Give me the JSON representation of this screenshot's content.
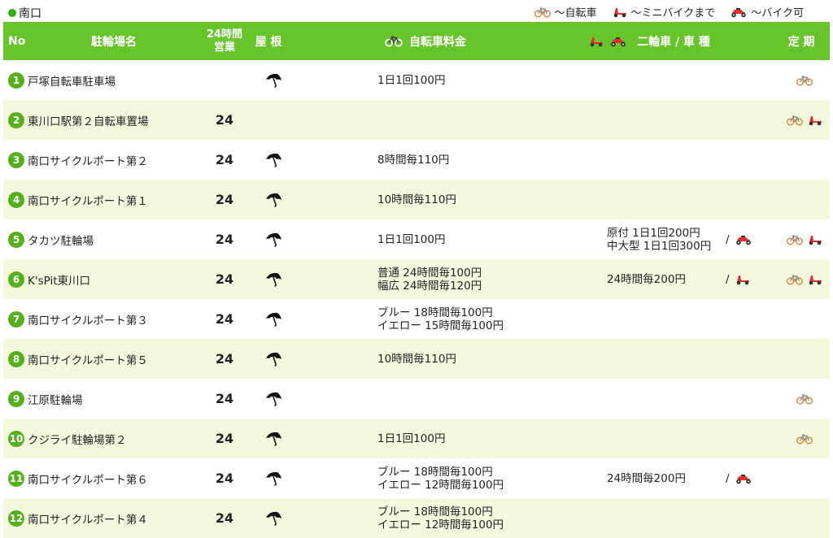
{
  "section": "南口",
  "legend": {
    "bicycle": "〜自転車",
    "mini": "〜ミニバイクまで",
    "bike": "〜バイク可"
  },
  "header": {
    "no": "No",
    "name": "駐輪場名",
    "hours_1": "24時間",
    "hours_2": "営業",
    "roof": "屋 根",
    "fee": "自転車料金",
    "moto": "二輪車 / 車 種",
    "teiki": "定 期"
  },
  "colors": {
    "header_green": "#67c42b",
    "badge_green": "#56b01e",
    "row_alt": "#f4f8dc",
    "icon_red": "#e03030"
  },
  "rows": [
    {
      "no": "1",
      "name": "戸塚自転車駐車場",
      "open24": "",
      "roof": true,
      "fee": [
        "1日1回100円"
      ],
      "moto": [],
      "moto_icons": [],
      "teiki": [
        "bicycle"
      ]
    },
    {
      "no": "2",
      "name": "東川口駅第２自転車置場",
      "open24": "24",
      "roof": false,
      "fee": [],
      "moto": [],
      "moto_icons": [],
      "teiki": [
        "bicycle",
        "mini"
      ]
    },
    {
      "no": "3",
      "name": "南口サイクルポート第２",
      "open24": "24",
      "roof": true,
      "fee": [
        "8時間毎110円"
      ],
      "moto": [],
      "moto_icons": [],
      "teiki": []
    },
    {
      "no": "4",
      "name": "南口サイクルポート第１",
      "open24": "24",
      "roof": true,
      "fee": [
        "10時間毎110円"
      ],
      "moto": [],
      "moto_icons": [],
      "teiki": []
    },
    {
      "no": "5",
      "name": "タカツ駐輪場",
      "open24": "24",
      "roof": true,
      "fee": [
        "1日1回100円"
      ],
      "moto": [
        "原付 1日1回200円",
        "中大型 1日1回300円"
      ],
      "moto_icons": [
        "bike"
      ],
      "teiki": [
        "bicycle",
        "mini"
      ]
    },
    {
      "no": "6",
      "name": "K'sPit東川口",
      "open24": "24",
      "roof": true,
      "fee": [
        "普通 24時間毎100円",
        "幅広 24時間毎120円"
      ],
      "moto": [
        "24時間毎200円"
      ],
      "moto_icons": [
        "mini"
      ],
      "teiki": [
        "bicycle",
        "mini"
      ]
    },
    {
      "no": "7",
      "name": "南口サイクルポート第３",
      "open24": "24",
      "roof": true,
      "fee": [
        "ブルー 18時間毎100円",
        "イエロー 15時間毎100円"
      ],
      "moto": [],
      "moto_icons": [],
      "teiki": []
    },
    {
      "no": "8",
      "name": "南口サイクルポート第５",
      "open24": "24",
      "roof": true,
      "fee": [
        "10時間毎110円"
      ],
      "moto": [],
      "moto_icons": [],
      "teiki": []
    },
    {
      "no": "9",
      "name": "江原駐輪場",
      "open24": "24",
      "roof": true,
      "fee": [],
      "moto": [],
      "moto_icons": [],
      "teiki": [
        "bicycle"
      ]
    },
    {
      "no": "10",
      "name": "クジライ駐輪場第２",
      "open24": "24",
      "roof": true,
      "fee": [
        "1日1回100円"
      ],
      "moto": [],
      "moto_icons": [],
      "teiki": [
        "bicycle"
      ]
    },
    {
      "no": "11",
      "name": "南口サイクルポート第６",
      "open24": "24",
      "roof": true,
      "fee": [
        "ブルー 18時間毎100円",
        "イエロー 12時間毎100円"
      ],
      "moto": [
        "24時間毎200円"
      ],
      "moto_icons": [
        "bike"
      ],
      "teiki": []
    },
    {
      "no": "12",
      "name": "南口サイクルポート第４",
      "open24": "24",
      "roof": true,
      "fee": [
        "ブルー 18時間毎100円",
        "イエロー 12時間毎100円"
      ],
      "moto": [],
      "moto_icons": [],
      "teiki": []
    }
  ]
}
